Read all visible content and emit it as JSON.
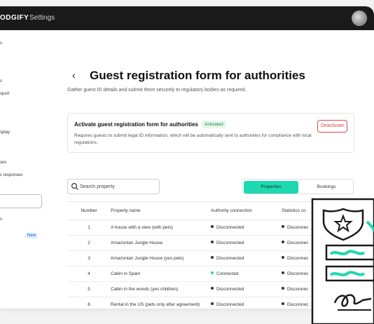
{
  "topbar": {
    "brand": "ODGIFY",
    "settings": "Settings"
  },
  "sidebar": {
    "fragments": [
      {
        "text": "s"
      },
      {
        "text": "s"
      },
      {
        "text": "xport"
      },
      {
        "text": "splay"
      },
      {
        "text": "ses"
      },
      {
        "text": "c responses"
      },
      {
        "text": "s"
      }
    ],
    "new_badge": "New"
  },
  "page": {
    "back": "‹",
    "title": "Guest registration form for authorities",
    "subtitle": "Gather guest ID details and submit them securely to regulatory bodies as required."
  },
  "card": {
    "title": "Activate guest registration form for authorities",
    "status": "Activated",
    "description": "Requires guests to submit legal ID information, which will be automatically sent to authorities for compliance with local regulations.",
    "deactivate": "Deactivate"
  },
  "search": {
    "placeholder": "Search property"
  },
  "tabs": {
    "properties": "Properties",
    "bookings": "Bookings"
  },
  "table": {
    "headers": {
      "number": "Number",
      "name": "Property name",
      "auth": "Authority connection",
      "stat": "Statistics co"
    },
    "rows": [
      {
        "number": "1",
        "name": "A house with a view (with pets)",
        "auth": "Disconnected",
        "stat": "Disconnec"
      },
      {
        "number": "2",
        "name": "Amazonian Jungle House",
        "auth": "Disconnected",
        "stat": "Disconnec"
      },
      {
        "number": "3",
        "name": "Amazonian Jungle House (yes pets)",
        "auth": "Disconnected",
        "stat": "Disconnec"
      },
      {
        "number": "4",
        "name": "Cabin in Spain",
        "auth": "Connected",
        "stat": "Disconnec"
      },
      {
        "number": "5",
        "name": "Cabin in the woods (yes children)",
        "auth": "Disconnected",
        "stat": "Disconnec"
      },
      {
        "number": "6",
        "name": "Rental in the US (pets only after agreement)",
        "auth": "Disconnected",
        "stat": "Disconnec"
      }
    ]
  },
  "colors": {
    "connected": "#1ed8b0",
    "disconnected": "#333333",
    "accent": "#1ed8b0",
    "danger": "#e04848"
  }
}
